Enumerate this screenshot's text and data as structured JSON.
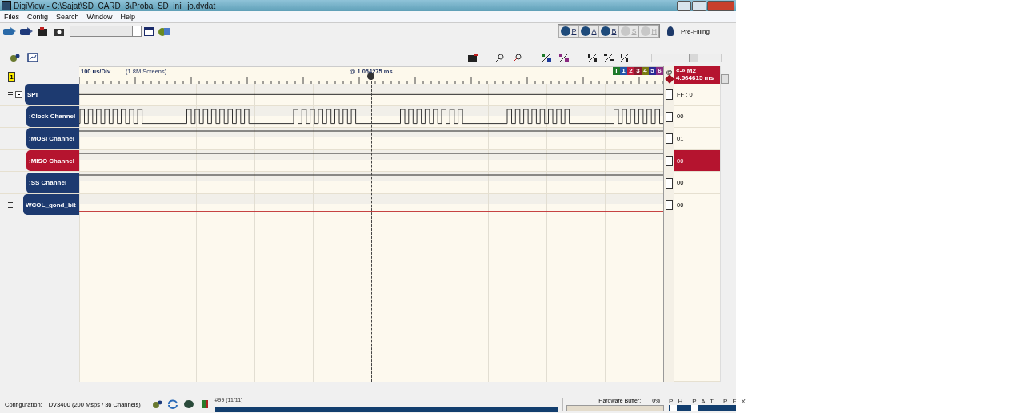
{
  "window": {
    "title": "DigiView - C:\\Sajat\\SD_CARD_3\\Proba_SD_inii_jo.dvdat"
  },
  "menu": [
    "Files",
    "Config",
    "Search",
    "Window",
    "Help"
  ],
  "capture_buttons": [
    {
      "label": "P",
      "disabled": false
    },
    {
      "label": "A",
      "disabled": false
    },
    {
      "label": "B",
      "disabled": false
    },
    {
      "label": "S",
      "disabled": true
    },
    {
      "label": "H",
      "disabled": true
    }
  ],
  "capture_status": "Pre-Filling",
  "marker_group": "1",
  "timeline": {
    "scale": "100 us/Div",
    "screens": "(1.8M Screens)",
    "cursor": "@ 1.054275 ms"
  },
  "marker_tabs": [
    {
      "label": "T",
      "color": "#1e7a2a"
    },
    {
      "label": "1",
      "color": "#2456a8"
    },
    {
      "label": "2",
      "color": "#c01c3c"
    },
    {
      "label": "3",
      "color": "#8a1a2e"
    },
    {
      "label": "4",
      "color": "#7a7a12"
    },
    {
      "label": "5",
      "color": "#2a2a94"
    },
    {
      "label": "6",
      "color": "#8a2a80"
    }
  ],
  "measurement": {
    "marker": "@",
    "title": "«-» M2",
    "value": "4.564615 ms"
  },
  "signals": [
    {
      "name": "SPI",
      "kind": "bus",
      "value": "FF : 0",
      "selected": false,
      "expanded": true,
      "children": [
        {
          "name": ":Clock Channel",
          "kind": "clock",
          "value": "00",
          "selected": false
        },
        {
          "name": ":MOSI Channel",
          "kind": "high",
          "value": "01",
          "selected": false
        },
        {
          "name": ":MISO Channel",
          "kind": "high",
          "value": "00",
          "selected": true
        },
        {
          "name": ":SS Channel",
          "kind": "high",
          "value": "00",
          "selected": false
        }
      ]
    },
    {
      "name": "WCOL_gond_bit",
      "kind": "low",
      "value": "00",
      "selected": false
    }
  ],
  "status_bar": {
    "configuration_label": "Configuration:",
    "configuration": "DV3400 (200 Msps / 36 Channels)",
    "capture": {
      "label": "#99 (11/11)",
      "level": 1
    },
    "hardware_buffer": {
      "label": "Hardware Buffer:",
      "reading": "0%",
      "level": 0
    },
    "modes": [
      "P H",
      "P A T",
      "P F X"
    ]
  }
}
